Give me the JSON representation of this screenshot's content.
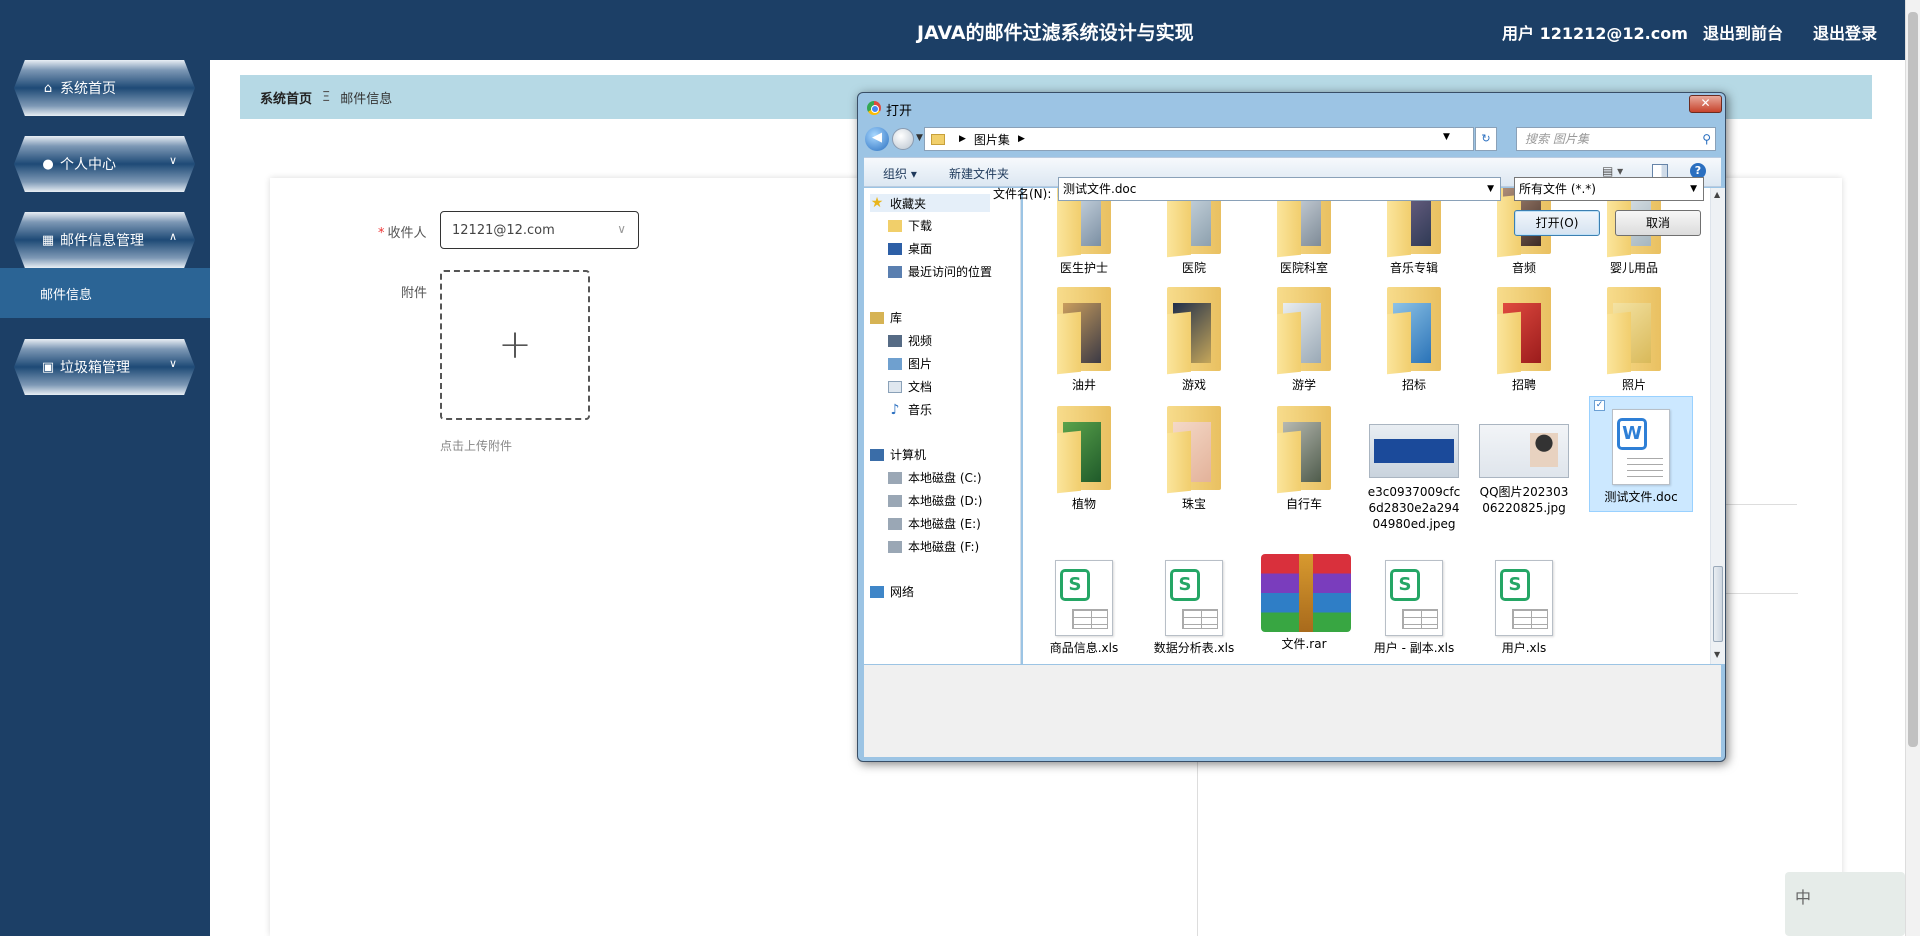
{
  "app": {
    "title": "JAVA的邮件过滤系统设计与实现",
    "user_label": "用户 121212@12.com",
    "to_front": "退出到前台",
    "logout": "退出登录"
  },
  "sidebar": {
    "items": [
      {
        "label": "系统首页",
        "icon": "home-icon"
      },
      {
        "label": "个人中心",
        "icon": "user-icon"
      },
      {
        "label": "邮件信息管理",
        "icon": "grid-icon"
      },
      {
        "label": "垃圾箱管理",
        "icon": "briefcase-icon"
      }
    ],
    "active_sub": "邮件信息"
  },
  "breadcrumb": {
    "home": "系统首页",
    "sep": "Ξ",
    "current": "邮件信息"
  },
  "form": {
    "recipient_label": "收件人",
    "recipient_value": "12121@12.com",
    "attachment_label": "附件",
    "upload_hint": "点击上传附件"
  },
  "ime": {
    "text": "中"
  },
  "dialog": {
    "title": "打开",
    "close": "✕",
    "path": "图片集",
    "search_placeholder": "搜索 图片集",
    "toolbar": {
      "organize": "组织 ▾",
      "new_folder": "新建文件夹",
      "help": "?"
    },
    "nav": {
      "favorites": "收藏夹",
      "downloads": "下载",
      "desktop": "桌面",
      "recent": "最近访问的位置",
      "library": "库",
      "videos": "视频",
      "pictures": "图片",
      "documents": "文档",
      "music": "音乐",
      "computer": "计算机",
      "disk_c": "本地磁盘 (C:)",
      "disk_d": "本地磁盘 (D:)",
      "disk_e": "本地磁盘 (E:)",
      "disk_f": "本地磁盘 (F:)",
      "network": "网络"
    },
    "files": {
      "f1": "医生护士",
      "f2": "医院",
      "f3": "医院科室",
      "f4": "音乐专辑",
      "f5": "音频",
      "f6": "婴儿用品",
      "f7": "油井",
      "f8": "游戏",
      "f9": "游学",
      "f10": "招标",
      "f11": "招聘",
      "f12": "照片",
      "f13": "植物",
      "f14": "珠宝",
      "f15": "自行车",
      "f16": "e3c0937009cfc6d2830e2a29404980ed.jpeg",
      "f17": "QQ图片20230306220825.jpg",
      "f18": "测试文件.doc",
      "f19": "商品信息.xls",
      "f20": "数据分析表.xls",
      "f21": "文件.rar",
      "f22": "用户 - 副本.xls",
      "f23": "用户.xls"
    },
    "filename_label": "文件名(N):",
    "filename_value": "测试文件.doc",
    "file_type": "所有文件 (*.*)",
    "open": "打开(O)",
    "cancel": "取消"
  }
}
